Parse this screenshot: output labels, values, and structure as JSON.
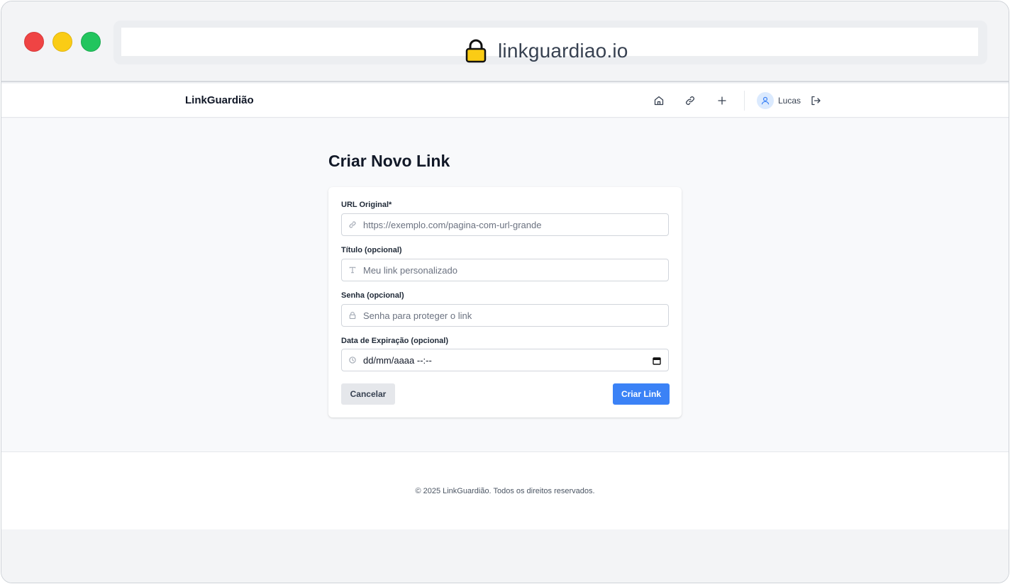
{
  "browser": {
    "url": "linkguardiao.io",
    "lock_icon": "lock-icon",
    "lock_color": "#facc15"
  },
  "navbar": {
    "brand": "LinkGuardião",
    "icons": [
      "home-icon",
      "link-icon",
      "plus-icon"
    ],
    "user_name": "Lucas",
    "logout_icon": "logout-icon"
  },
  "page": {
    "title": "Criar Novo Link"
  },
  "form": {
    "url_label": "URL Original*",
    "url_placeholder": "https://exemplo.com/pagina-com-url-grande",
    "title_label": "Título (opcional)",
    "title_placeholder": "Meu link personalizado",
    "password_label": "Senha (opcional)",
    "password_placeholder": "Senha para proteger o link",
    "expiry_label": "Data de Expiração (opcional)",
    "expiry_value": "dd/mm/aaaa --:--",
    "cancel_label": "Cancelar",
    "submit_label": "Criar Link"
  },
  "footer": {
    "text": "© 2025 LinkGuardião. Todos os direitos reservados."
  },
  "colors": {
    "accent": "#3b82f6",
    "avatar_bg": "#dbeafe"
  }
}
